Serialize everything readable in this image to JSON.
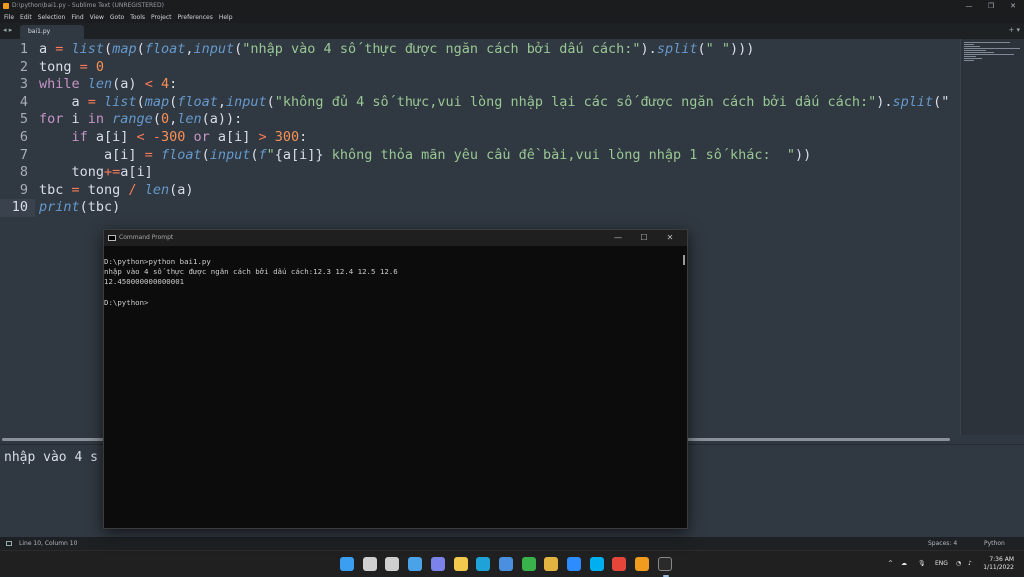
{
  "window": {
    "title": "D:\\python\\bai1.py - Sublime Text (UNREGISTERED)",
    "controls": [
      "—",
      "❐",
      "✕"
    ]
  },
  "menu": [
    "File",
    "Edit",
    "Selection",
    "Find",
    "View",
    "Goto",
    "Tools",
    "Project",
    "Preferences",
    "Help"
  ],
  "tabs": {
    "nav": "◂ ▸",
    "active": "bai1.py",
    "right": "+ ▾"
  },
  "editor": {
    "line_numbers": [
      "1",
      "2",
      "3",
      "4",
      "5",
      "6",
      "7",
      "8",
      "9",
      "10"
    ],
    "active_line": 10,
    "lines": [
      [
        [
          "v",
          "a "
        ],
        [
          "o",
          "= "
        ],
        [
          "f",
          "list"
        ],
        [
          "v",
          "("
        ],
        [
          "f",
          "map"
        ],
        [
          "v",
          "("
        ],
        [
          "f",
          "float"
        ],
        [
          "v",
          ","
        ],
        [
          "f",
          "input"
        ],
        [
          "v",
          "("
        ],
        [
          "s",
          "\"nhập vào 4 số thực được ngăn cách bởi dấu cách:\""
        ],
        [
          "v",
          ")."
        ],
        [
          "f",
          "split"
        ],
        [
          "v",
          "("
        ],
        [
          "s",
          "\" \""
        ],
        [
          "v",
          ")))"
        ]
      ],
      [
        [
          "v",
          "tong "
        ],
        [
          "o",
          "= "
        ],
        [
          "n",
          "0"
        ]
      ],
      [
        [
          "k",
          "while "
        ],
        [
          "f",
          "len"
        ],
        [
          "v",
          "(a) "
        ],
        [
          "o",
          "< "
        ],
        [
          "n",
          "4"
        ],
        [
          "v",
          ":"
        ]
      ],
      [
        [
          "v",
          "    a "
        ],
        [
          "o",
          "= "
        ],
        [
          "f",
          "list"
        ],
        [
          "v",
          "("
        ],
        [
          "f",
          "map"
        ],
        [
          "v",
          "("
        ],
        [
          "f",
          "float"
        ],
        [
          "v",
          ","
        ],
        [
          "f",
          "input"
        ],
        [
          "v",
          "("
        ],
        [
          "s",
          "\"không đủ 4 số thực,vui lòng nhập lại các số được ngăn cách bởi dấu cách:\""
        ],
        [
          "v",
          ")."
        ],
        [
          "f",
          "split"
        ],
        [
          "v",
          "(\""
        ]
      ],
      [
        [
          "k",
          "for "
        ],
        [
          "v",
          "i "
        ],
        [
          "k",
          "in "
        ],
        [
          "f",
          "range"
        ],
        [
          "v",
          "("
        ],
        [
          "n",
          "0"
        ],
        [
          "v",
          ","
        ],
        [
          "f",
          "len"
        ],
        [
          "v",
          "(a)):"
        ]
      ],
      [
        [
          "k",
          "    if "
        ],
        [
          "v",
          "a[i] "
        ],
        [
          "o",
          "< -"
        ],
        [
          "n",
          "300 "
        ],
        [
          "k",
          "or "
        ],
        [
          "v",
          "a[i] "
        ],
        [
          "o",
          "> "
        ],
        [
          "n",
          "300"
        ],
        [
          "v",
          ":"
        ]
      ],
      [
        [
          "v",
          "        a[i] "
        ],
        [
          "o",
          "= "
        ],
        [
          "f",
          "float"
        ],
        [
          "v",
          "("
        ],
        [
          "f",
          "input"
        ],
        [
          "v",
          "("
        ],
        [
          "f",
          "f"
        ],
        [
          "s",
          "\""
        ],
        [
          "v",
          "{a[i]}"
        ],
        [
          "s",
          " không thỏa mãn yêu cầu đề bài,vui lòng nhập 1 số khác:  \""
        ],
        [
          "v",
          "))"
        ]
      ],
      [
        [
          "v",
          "    tong"
        ],
        [
          "o",
          "+="
        ],
        [
          "v",
          "a[i]"
        ]
      ],
      [
        [
          "v",
          "tbc "
        ],
        [
          "o",
          "= "
        ],
        [
          "v",
          "tong "
        ],
        [
          "o",
          "/ "
        ],
        [
          "f",
          "len"
        ],
        [
          "v",
          "(a)"
        ]
      ],
      [
        [
          "f",
          "print"
        ],
        [
          "v",
          "(tbc)"
        ]
      ]
    ]
  },
  "console": {
    "text": "nhập vào 4 s"
  },
  "statusbar": {
    "position": "Line 10, Column 10",
    "spaces": "Spaces: 4",
    "syntax": "Python"
  },
  "cmd": {
    "title": "Command Prompt",
    "controls": [
      "—",
      "☐",
      "✕"
    ],
    "lines": [
      "D:\\python>python bai1.py",
      "nhập vào 4 số thực được ngăn cách bởi dấu cách:12.3 12.4 12.5 12.6",
      "12.450000000000001",
      "",
      "D:\\python>"
    ]
  },
  "taskbar": {
    "icons": [
      {
        "name": "windows-start-icon",
        "color": "#3a9ff0"
      },
      {
        "name": "search-icon",
        "color": "#d0d0d0"
      },
      {
        "name": "task-view-icon",
        "color": "#cfcfcf"
      },
      {
        "name": "widgets-icon",
        "color": "#4aa3e8"
      },
      {
        "name": "teams-chat-icon",
        "color": "#7b83eb"
      },
      {
        "name": "file-explorer-icon",
        "color": "#f2c94c"
      },
      {
        "name": "edge-browser-icon",
        "color": "#1fa2d8"
      },
      {
        "name": "store-icon",
        "color": "#4a8fe0"
      },
      {
        "name": "app-green-icon",
        "color": "#38b24a"
      },
      {
        "name": "slack-icon",
        "color": "#e3b341"
      },
      {
        "name": "zoom-icon",
        "color": "#2d8cff"
      },
      {
        "name": "skype-icon",
        "color": "#00aff0"
      },
      {
        "name": "chrome-icon",
        "color": "#e6463a"
      },
      {
        "name": "sublime-text-icon",
        "color": "#f29c1f"
      },
      {
        "name": "terminal-icon",
        "color": "#2a2a2a"
      }
    ],
    "tray": {
      "chevron": "^",
      "lang": "ENG",
      "time": "7:36 AM",
      "date": "1/11/2022"
    }
  },
  "colors": {
    "editor_bg": "#303841",
    "keyword": "#c695c6",
    "function": "#6699cc",
    "string": "#99c794",
    "number": "#f99157",
    "operator": "#f97b58"
  }
}
